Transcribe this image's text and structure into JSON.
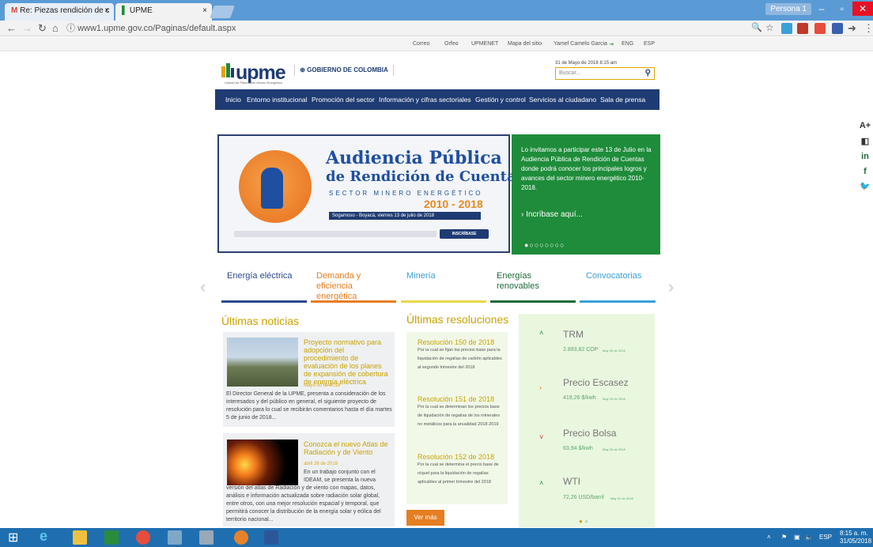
{
  "browser": {
    "tabs": [
      {
        "label": "Re: Piezas rendición de c"
      },
      {
        "label": "UPME"
      }
    ],
    "url": "www1.upme.gov.co/Paginas/default.aspx",
    "profile": "Persona 1",
    "close_glyph": "×"
  },
  "site": {
    "toplinks": [
      "Correo",
      "Orfeo",
      "UPMENET",
      "Mapa del sitio",
      "Yamel Camelo Garcia",
      "ENG",
      "ESP"
    ],
    "logo": "upme",
    "logo_sub": "Unidad de Planeación Minero Energética",
    "gov": "GOBIERNO DE COLOMBIA",
    "date": "31 de Mayo de 2018 8:15 am",
    "search_placeholder": "Buscar...",
    "menu": [
      "Inicio",
      "Entorno institucional",
      "Promoción del sector",
      "Información y cifras sectoriales",
      "Gestión y control",
      "Servicios al ciudadano",
      "Sala de prensa"
    ],
    "banner": {
      "title1": "Audiencia Pública",
      "title2": "de Rendición de Cuentas",
      "sector": "SECTOR MINERO ENERGÉTICO",
      "years": "2010 - 2018",
      "place": "Sogamoso - Boyacá, viernes 13 de julio de 2018",
      "button": "INSCRÍBASE"
    },
    "green": {
      "text": "Lo invitamos a participar este 13 de Julio en la Audiencia Pública de Rendición de Cuentas donde podrá conocer los principales logros y avances del sector minero energético 2010-2018.",
      "link": "› Incríbase aquí...",
      "dots": "●○○○○○○○"
    },
    "categories": [
      {
        "label": "Energía eléctrica",
        "color": "#2c4a8c"
      },
      {
        "label": "Demanda y eficiencia energética",
        "color": "#e67e22"
      },
      {
        "label": "Minería",
        "color": "#e6d84a"
      },
      {
        "label": "Energías renovables",
        "color": "#1e6b3a"
      },
      {
        "label": "Convocatorias",
        "color": "#3aa0d8"
      }
    ],
    "news_title": "Últimas noticias",
    "news": [
      {
        "title": "Proyecto normativo para adopción del procedimiento de evaluación de los planes de expansión de cobertura de energía eléctrica",
        "date": "Mayo 30 de 2018",
        "body": "El Director General de la UPME, presenta a consideración de los interesados y del público en general, el siguiente proyecto de resolución para lo cual se recibirán comentarios hasta el día martes 5 de junio de 2018..."
      },
      {
        "title": "Conozca el nuevo Atlas de Radiación y de Viento",
        "date": "abril 26 de 2018",
        "body_top": "En un trabajo conjunto con el IDEAM, se presenta la nueva",
        "body": "versión del atlas de Radiación y de viento con mapas, datos, análisis e información actualizada sobre radiación solar global, entre otros, con una mejor resolución espacial y temporal, que permitirá conocer la distribución de la energía solar y eólica del territorio nacional..."
      }
    ],
    "res_title": "Últimas resoluciones",
    "resoluciones": [
      {
        "title": "Resolución 150 de 2018",
        "body": "Por la cual se fijan los precios base para la liquidación de regalías de carbón aplicables al segundo trimestre del 2018"
      },
      {
        "title": "Resolución 151 de 2018",
        "body": "Por la cual se determinan los precios base de liquidación de regalías de los minerales no metálicos para la anualidad 2018-2019"
      },
      {
        "title": "Resolución 152 de 2018",
        "body": "Por la cual se determina el precio base de níquel para la liquidación de regalías aplicables al primer trimestre del 2018"
      }
    ],
    "ver_mas": "Ver más",
    "indicators": [
      {
        "name": "TRM",
        "value": "2.893,82 COP",
        "date": "May 30 de 2018",
        "arrow": "˄",
        "arrow_color": "#1e8c3a"
      },
      {
        "name": "Precio Escasez",
        "value": "419,26 $/kwh",
        "date": "May 30 de 2018",
        "arrow": "›",
        "arrow_color": "#e67e22"
      },
      {
        "name": "Precio Bolsa",
        "value": "63,94 $/kwh",
        "date": "May 30 de 2018",
        "arrow": "˅",
        "arrow_color": "#c0392b"
      },
      {
        "name": "WTI",
        "value": "72,26 USD/barril",
        "date": "May 31 de 2018",
        "arrow": "˄",
        "arrow_color": "#1e8c3a"
      }
    ],
    "social": [
      "A+",
      "◧",
      "in",
      "f",
      "🐦"
    ]
  },
  "taskbar": {
    "lang": "ESP",
    "time": "8:15 a. m.",
    "date": "31/05/2018"
  }
}
